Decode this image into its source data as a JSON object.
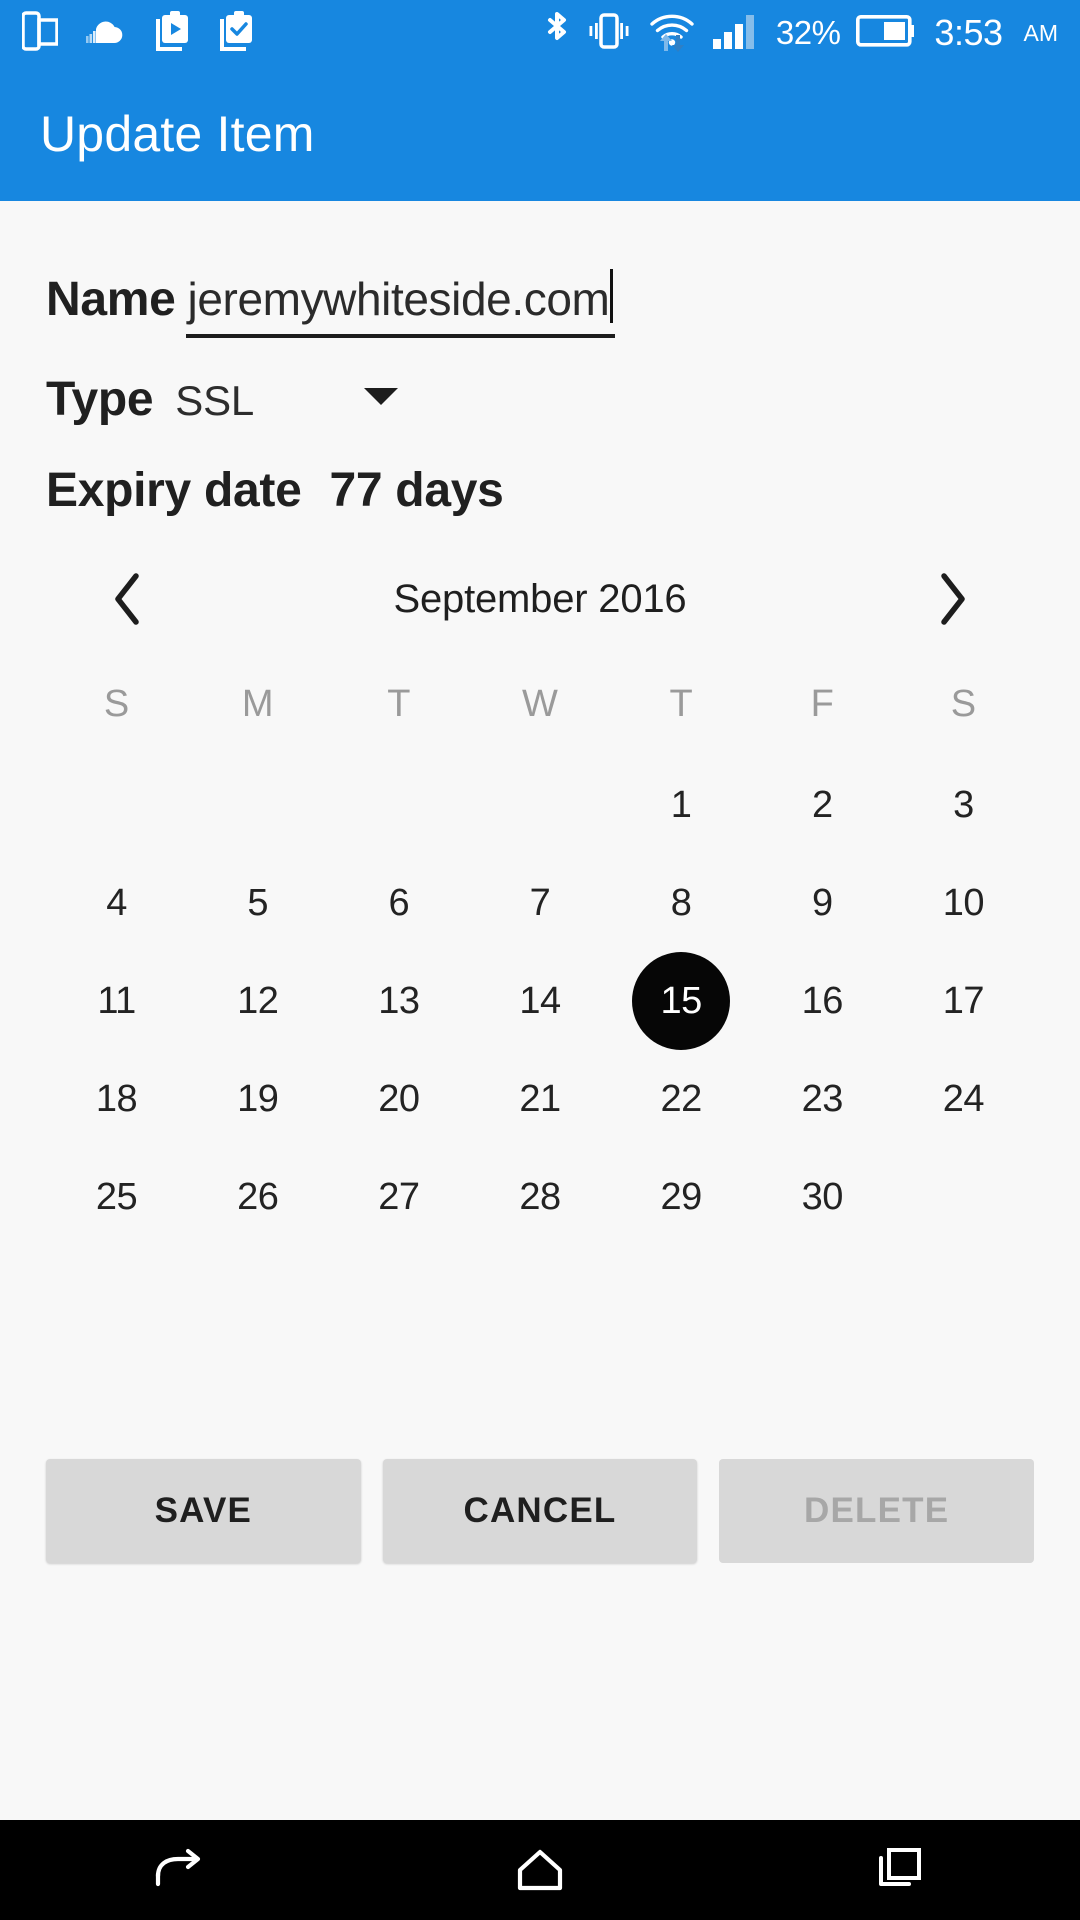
{
  "status_bar": {
    "background": "#1787e0",
    "left_icons": [
      {
        "name": "multi-window-icon"
      },
      {
        "name": "soundcloud-cloud-icon"
      },
      {
        "name": "clipboard-play-icon"
      },
      {
        "name": "clipboard-check-icon"
      }
    ],
    "right_icons": [
      {
        "name": "bluetooth-icon"
      },
      {
        "name": "vibrate-icon"
      },
      {
        "name": "wifi-data-icon"
      },
      {
        "name": "signal-bars-icon"
      }
    ],
    "battery_percent": "32%",
    "time": "3:53",
    "am_pm": "AM"
  },
  "app_bar": {
    "title": "Update Item",
    "background": "#1787e0"
  },
  "form": {
    "name": {
      "label": "Name",
      "value": "jeremywhiteside.com",
      "placeholder": "Name"
    },
    "type": {
      "label": "Type",
      "value": "SSL",
      "options": [
        "SSL"
      ]
    },
    "expiry": {
      "label": "Expiry date",
      "value": "77 days"
    }
  },
  "calendar": {
    "month_label": "September 2016",
    "prev_label": "‹",
    "next_label": "›",
    "weekdays": [
      "S",
      "M",
      "T",
      "W",
      "T",
      "F",
      "S"
    ],
    "selected_day": 15,
    "selected_color": "#060606",
    "weeks": [
      [
        "",
        "",
        "",
        "",
        "1",
        "2",
        "3"
      ],
      [
        "4",
        "5",
        "6",
        "7",
        "8",
        "9",
        "10"
      ],
      [
        "11",
        "12",
        "13",
        "14",
        "15",
        "16",
        "17"
      ],
      [
        "18",
        "19",
        "20",
        "21",
        "22",
        "23",
        "24"
      ],
      [
        "25",
        "26",
        "27",
        "28",
        "29",
        "30",
        ""
      ]
    ]
  },
  "buttons": {
    "save": "SAVE",
    "cancel": "CANCEL",
    "delete": "DELETE",
    "delete_disabled": true
  },
  "nav_bar": {
    "back": "back-icon",
    "home": "home-icon",
    "recents": "recents-icon"
  }
}
